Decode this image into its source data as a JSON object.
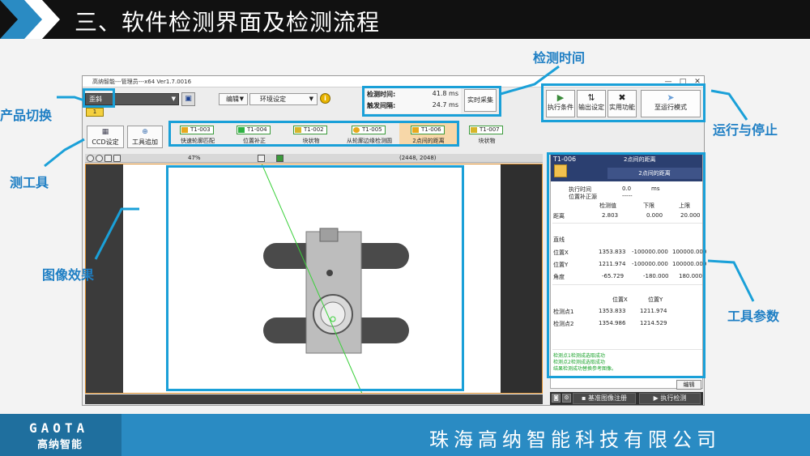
{
  "slide": {
    "title": "三、软件检测界面及检测流程",
    "logo": "GAOTA",
    "logo_sub": "高纳智能",
    "company": "珠海高纳智能科技有限公司"
  },
  "annotations": {
    "product_switch": "产品切换",
    "detect_tool": "测工具",
    "image_effect": "图像效果",
    "detect_time": "检测时间",
    "run_stop": "运行与停止",
    "tool_params": "工具参数"
  },
  "window": {
    "title": "高纳智能---管理员---x64 Ver1.7.0016",
    "min_icon": "—",
    "max_icon": "□",
    "close_icon": "✕"
  },
  "product": {
    "selected": "歪斜",
    "tab": "1"
  },
  "menus": {
    "edit": "编辑",
    "env": "环境设定"
  },
  "timing": {
    "detect_label": "检测时间:",
    "detect_value": "41.8 ms",
    "trigger_label": "触发间隔:",
    "trigger_value": "24.7 ms",
    "realtime_btn": "实时采集"
  },
  "controls": {
    "exec_cond": "执行条件",
    "output_set": "输出设定",
    "util": "实用功能",
    "to_run": "至运行模式"
  },
  "tool_buttons": {
    "ccd": "CCD设定",
    "add": "工具追加"
  },
  "tools": [
    {
      "id": "T1-003",
      "name": "快速轮廓匹配"
    },
    {
      "id": "T1-004",
      "name": "位置补正"
    },
    {
      "id": "T1-002",
      "name": "块状物"
    },
    {
      "id": "T1-005",
      "name": "从轮廓边缘检测圆"
    },
    {
      "id": "T1-006",
      "name": "2点间的距离"
    },
    {
      "id": "T1-007",
      "name": "块状物"
    }
  ],
  "image_bar": {
    "zoom": "47%",
    "coord": "(2448, 2048)"
  },
  "param": {
    "id": "T1-006",
    "name": "2点间的距离",
    "name_sub": "2点间的距离",
    "exec_time_label": "执行时间",
    "exec_time_value": "0.0",
    "exec_time_unit": "ms",
    "pos_corr_label": "位置补正源",
    "pos_corr_value": "-----",
    "hdr_value": "检测值",
    "hdr_low": "下限",
    "hdr_high": "上限",
    "dist_label": "距离",
    "dist_value": "2.803",
    "dist_low": "0.000",
    "dist_high": "20.000",
    "line_label": "直线",
    "px_label": "位置X",
    "px_value": "1353.833",
    "px_low": "-100000.000",
    "px_high": "100000.000",
    "py_label": "位置Y",
    "py_value": "1211.974",
    "py_low": "-100000.000",
    "py_high": "100000.000",
    "ang_label": "角度",
    "ang_value": "-65.729",
    "ang_low": "-180.000",
    "ang_high": "180.000",
    "hdr_posx": "位置X",
    "hdr_posy": "位置Y",
    "p1_label": "检测点1",
    "p1_x": "1353.833",
    "p1_y": "1211.974",
    "p2_label": "检测点2",
    "p2_x": "1354.986",
    "p2_y": "1214.529",
    "msg1": "检测点1检测成选取成功",
    "msg2": "检测点2检测成选取成功",
    "msg3": "结果检测成功替换参考图像。",
    "edit_btn": "编辑",
    "base_btn": "基准图像注册",
    "exec_btn": "执行检测"
  },
  "colors": {
    "annotation": "#1f7fc4",
    "frame": "#1aa0d8",
    "footer": "#2a8bc3"
  }
}
